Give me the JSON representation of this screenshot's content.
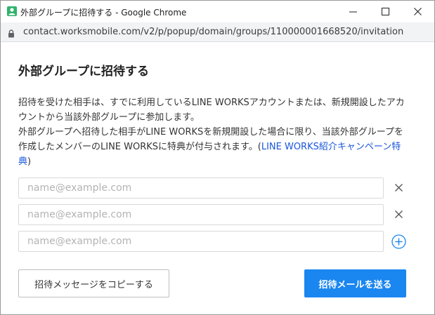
{
  "window": {
    "title": "外部グループに招待する - Google Chrome",
    "icon": "user-icon",
    "controls": {
      "minimize": "minimize-icon",
      "maximize": "maximize-icon",
      "close": "close-icon"
    }
  },
  "address_bar": {
    "url": "contact.worksmobile.com/v2/p/popup/domain/groups/110000001668520/invitation",
    "icon": "lock-icon"
  },
  "dialog": {
    "title": "外部グループに招待する",
    "description_1": "招待を受けた相手は、すでに利用しているLINE WORKSアカウントまたは、新規開設したアカウントから当該外部グループに参加します。",
    "description_2_prefix": "外部グループへ招待した相手がLINE WORKSを新規開設した場合に限り、当該外部グループを作成したメンバーのLINE WORKSに特典が付与されます。(",
    "description_2_link": "LINE WORKS紹介キャンペーン特典",
    "description_2_suffix": ")",
    "email_fields": [
      {
        "value": "",
        "placeholder": "name@example.com",
        "action": "remove-icon"
      },
      {
        "value": "",
        "placeholder": "name@example.com",
        "action": "remove-icon"
      },
      {
        "value": "",
        "placeholder": "name@example.com",
        "action": "add-circle-icon"
      }
    ],
    "copy_button_label": "招待メッセージをコピーする",
    "send_button_label": "招待メールを送る"
  },
  "colors": {
    "accent": "#1a86f0",
    "link": "#1a56db",
    "app_icon": "#2fb36b"
  }
}
